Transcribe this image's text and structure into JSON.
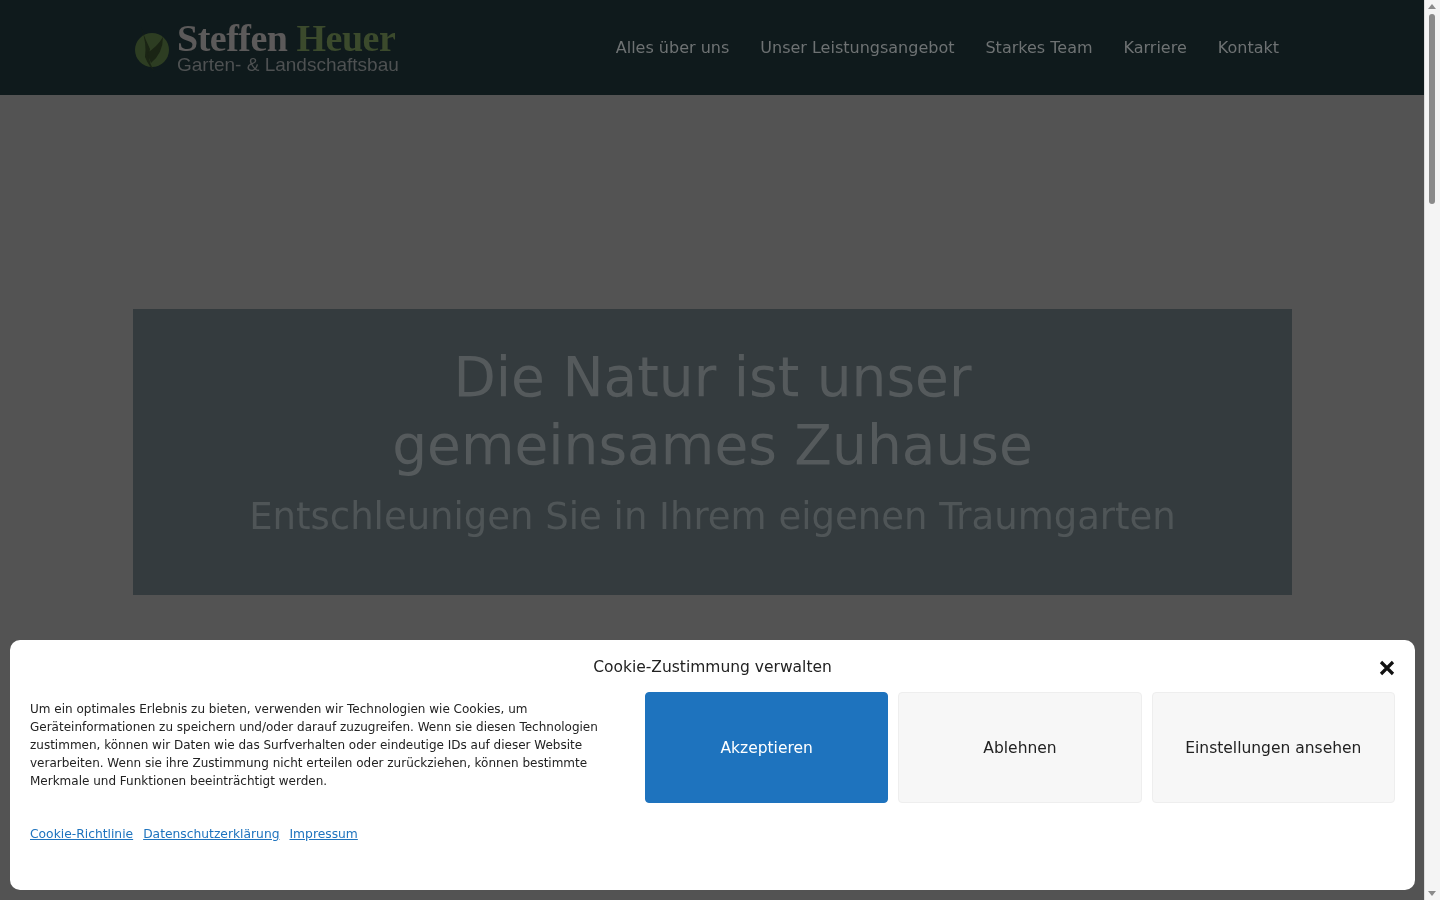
{
  "header": {
    "logo": {
      "name_first": "Steffen",
      "name_second": "Heuer",
      "tagline": "Garten- & Landschaftsbau"
    },
    "nav": [
      {
        "label": "Alles über uns"
      },
      {
        "label": "Unser Leistungsangebot"
      },
      {
        "label": "Starkes Team"
      },
      {
        "label": "Karriere"
      },
      {
        "label": "Kontakt"
      }
    ]
  },
  "hero": {
    "title": "Die Natur ist unser gemeinsames Zuhause",
    "subtitle": "Entschleunigen Sie in Ihrem eigenen Traumgarten"
  },
  "cookie_dialog": {
    "title": "Cookie-Zustimmung verwalten",
    "text": "Um ein optimales Erlebnis zu bieten, verwenden wir Technologien wie Cookies, um Geräteinformationen zu speichern und/oder darauf zuzugreifen. Wenn sie diesen Technologien zustimmen, können wir Daten wie das Surfverhalten oder eindeutige IDs auf dieser Website verarbeiten. Wenn sie ihre Zustimmung nicht erteilen oder zurückziehen, können bestimmte Merkmale und Funktionen beeinträchtigt werden.",
    "buttons": [
      {
        "label": "Akzeptieren",
        "kind": "primary"
      },
      {
        "label": "Ablehnen",
        "kind": "secondary"
      },
      {
        "label": "Einstellungen ansehen",
        "kind": "secondary"
      }
    ],
    "links": [
      {
        "label": "Cookie-Richtlinie"
      },
      {
        "label": "Datenschutzerklärung"
      },
      {
        "label": "Impressum"
      }
    ]
  }
}
